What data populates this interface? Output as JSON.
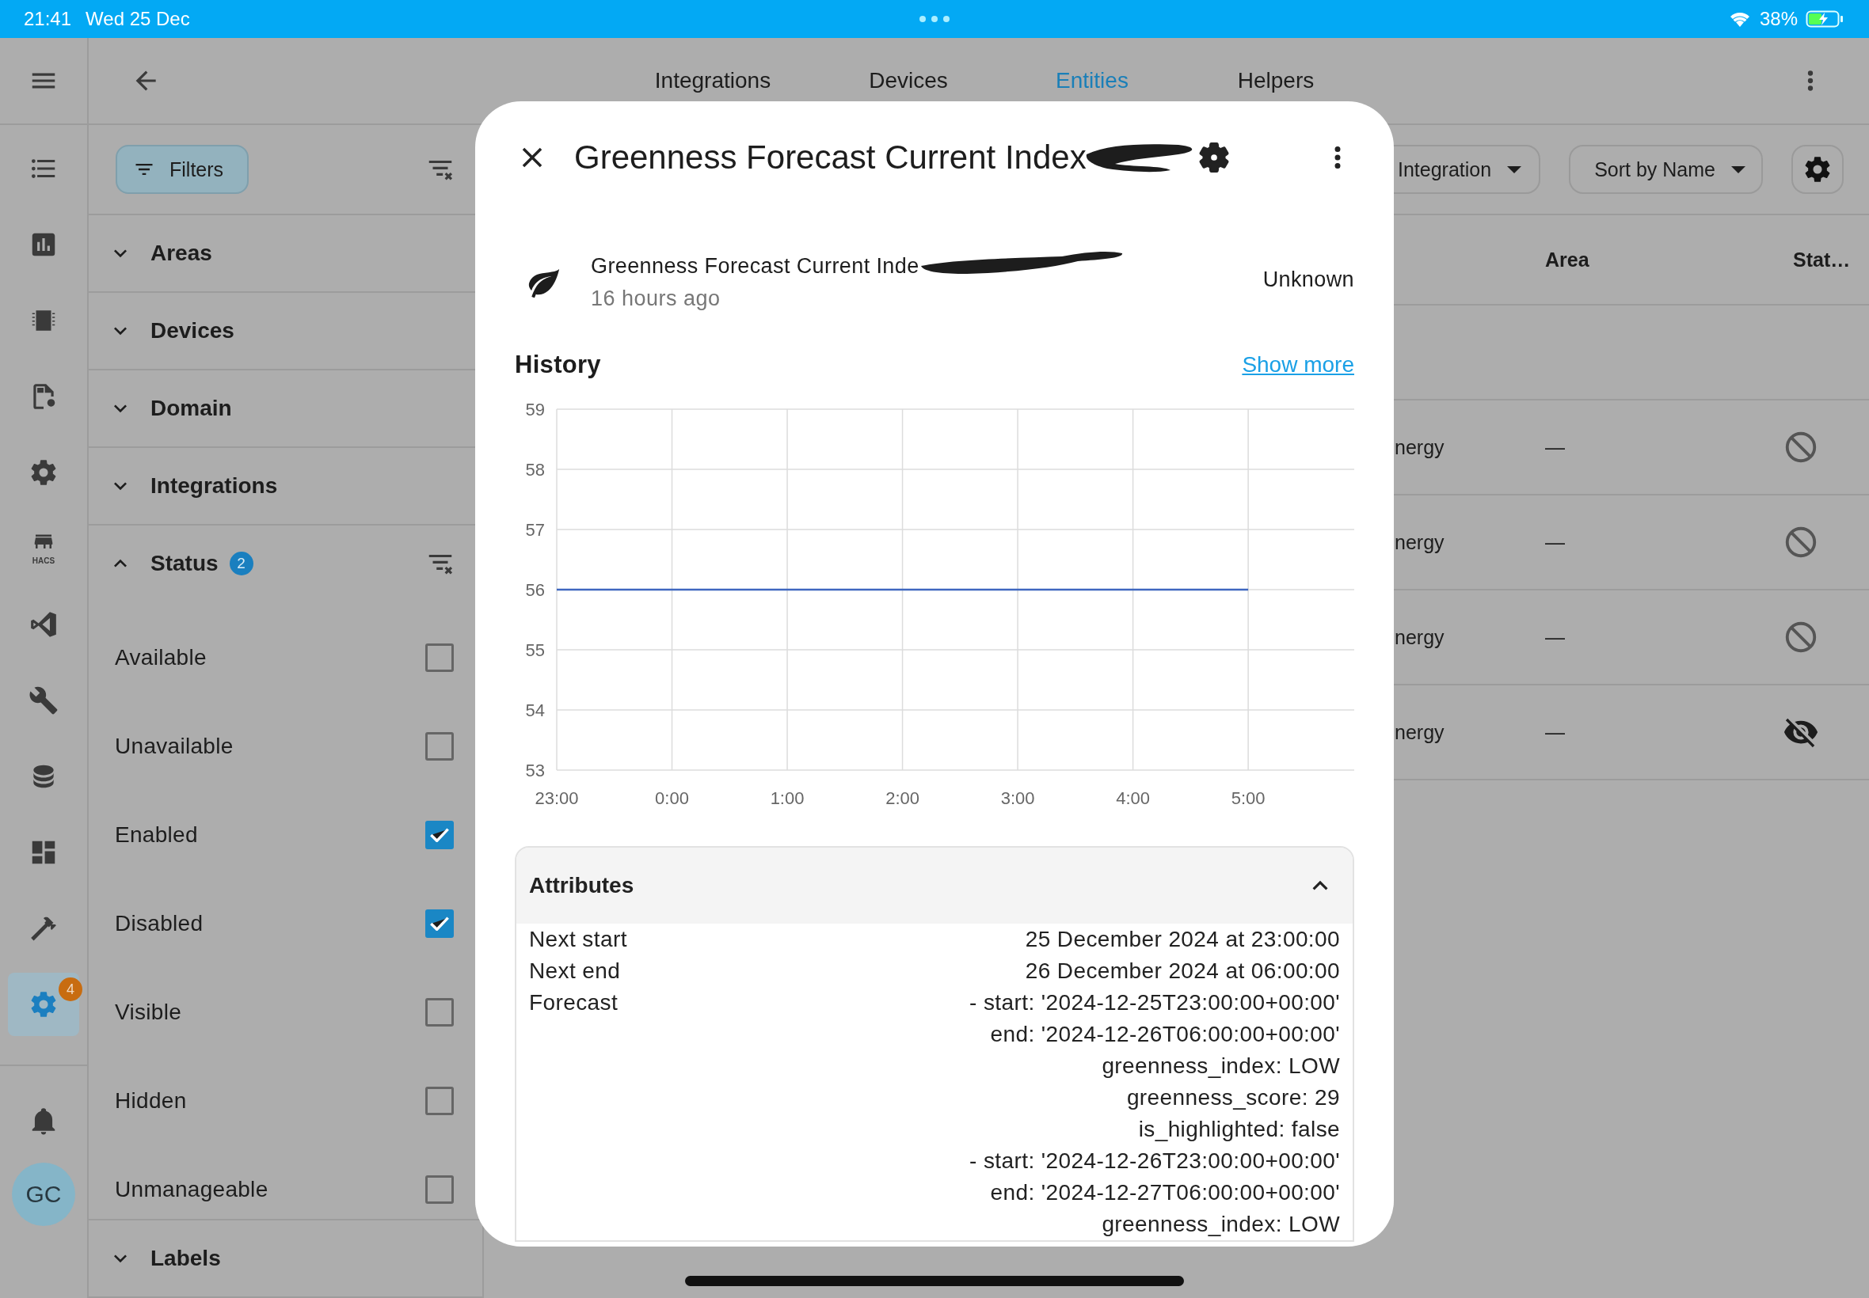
{
  "status_bar": {
    "time": "21:41",
    "date": "Wed 25 Dec",
    "battery": "38%"
  },
  "sidebar": {
    "items": [
      {
        "selected": false
      },
      {
        "selected": false
      },
      {
        "selected": false
      },
      {
        "selected": false
      },
      {
        "selected": false
      },
      {
        "selected": false,
        "label": "HACS"
      },
      {
        "selected": false
      },
      {
        "selected": false
      },
      {
        "selected": false
      },
      {
        "selected": false
      },
      {
        "selected": false
      },
      {
        "selected": true,
        "badge": "4"
      }
    ],
    "avatar": "GC"
  },
  "header": {
    "tabs": [
      {
        "label": "Integrations",
        "selected": false
      },
      {
        "label": "Devices",
        "selected": false
      },
      {
        "label": "Entities",
        "selected": true
      },
      {
        "label": "Helpers",
        "selected": false
      }
    ]
  },
  "filters": {
    "button": "Filters",
    "sections": [
      {
        "label": "Areas",
        "expanded": false
      },
      {
        "label": "Devices",
        "expanded": false
      },
      {
        "label": "Domain",
        "expanded": false
      },
      {
        "label": "Integrations",
        "expanded": false
      },
      {
        "label": "Status",
        "expanded": true,
        "badge": "2",
        "options": [
          {
            "label": "Available",
            "checked": false
          },
          {
            "label": "Unavailable",
            "checked": false
          },
          {
            "label": "Enabled",
            "checked": true
          },
          {
            "label": "Disabled",
            "checked": true
          },
          {
            "label": "Visible",
            "checked": false
          },
          {
            "label": "Hidden",
            "checked": false
          },
          {
            "label": "Unmanageable",
            "checked": false
          }
        ]
      },
      {
        "label": "Labels",
        "expanded": false
      }
    ]
  },
  "table": {
    "group_by": "Integration",
    "sort": "Sort by Name",
    "columns": [
      "Area",
      "Stat…"
    ],
    "rows": [
      {
        "column_1": "nergy",
        "area": "—",
        "kind": "disabled"
      },
      {
        "column_1": "nergy",
        "area": "—",
        "kind": "disabled"
      },
      {
        "column_1": "nergy",
        "area": "—",
        "kind": "disabled"
      },
      {
        "column_1": "nergy",
        "area": "—",
        "kind": "hidden"
      }
    ]
  },
  "dialog": {
    "title": "Greenness Forecast Current Index",
    "entity": {
      "name": "Greenness Forecast Current Inde",
      "updated": "16 hours ago",
      "state": "Unknown"
    },
    "history": {
      "title": "History",
      "link": "Show more",
      "chart_data": {
        "type": "line",
        "grid": true,
        "categories": [
          "23:00",
          "0:00",
          "1:00",
          "2:00",
          "3:00",
          "4:00",
          "5:00"
        ],
        "ylim": [
          53,
          59
        ],
        "yticks": [
          53,
          54,
          55,
          56,
          57,
          58,
          59
        ],
        "series": [
          {
            "color": "#3f67c0",
            "values": [
              56,
              56,
              56,
              56,
              56,
              56,
              56
            ]
          }
        ]
      }
    },
    "attributes": {
      "title": "Attributes",
      "expanded": true,
      "rows": [
        {
          "name": "Next start",
          "lines": [
            "25 December 2024 at 23:00:00"
          ]
        },
        {
          "name": "Next end",
          "lines": [
            "26 December 2024 at 06:00:00"
          ]
        },
        {
          "name": "Forecast",
          "lines": [
            "- start: '2024-12-25T23:00:00+00:00'",
            "end: '2024-12-26T06:00:00+00:00'",
            "greenness_index: LOW",
            "greenness_score: 29",
            "is_highlighted: false",
            "- start: '2024-12-26T23:00:00+00:00'",
            "end: '2024-12-27T06:00:00+00:00'",
            "greenness_index: LOW"
          ]
        }
      ]
    }
  }
}
